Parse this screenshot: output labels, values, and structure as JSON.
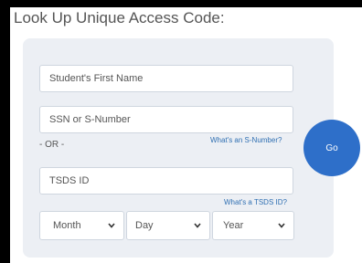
{
  "title": "Look Up Unique Access Code:",
  "form": {
    "first_name_placeholder": "Student's First Name",
    "ssn_placeholder": "SSN or S-Number",
    "s_number_help_link": "What's an S-Number?",
    "or_label": "- OR -",
    "tsds_placeholder": "TSDS ID",
    "tsds_help_link": "What's a TSDS ID?",
    "month_value": "Month",
    "day_value": "Day",
    "year_value": "Year",
    "go_label": "Go"
  },
  "colors": {
    "accent": "#2e6fc9",
    "link": "#2f6fb2",
    "panel_background": "#eceff4"
  },
  "icons": [
    "chevron-down-icon"
  ]
}
